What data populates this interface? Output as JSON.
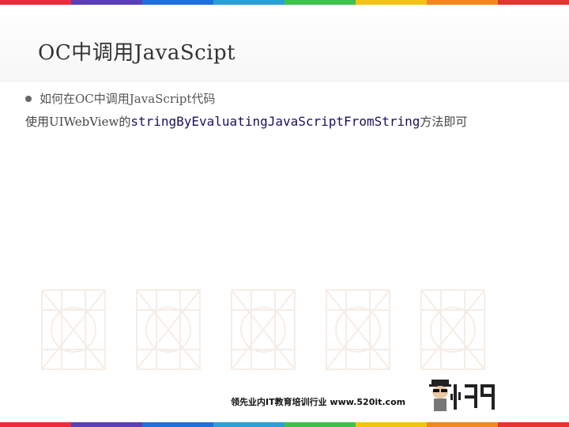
{
  "stripe_colors": [
    "#ee2a3c",
    "#5a3fb6",
    "#1f6fdd",
    "#2aa0d6",
    "#3fc24a",
    "#f2c40e",
    "#f2881d",
    "#e8332f"
  ],
  "slide": {
    "title": "OC中调用JavaScipt",
    "bullet": "如何在OC中调用JavaScript代码",
    "body_prefix": "使用UIWebView的",
    "body_code": "stringByEvaluatingJavaScriptFromString",
    "body_suffix": "方法即可"
  },
  "footer": {
    "tagline": "领先业内IT教育培训行业 www.520it.com"
  },
  "logo_text": "小码哥"
}
